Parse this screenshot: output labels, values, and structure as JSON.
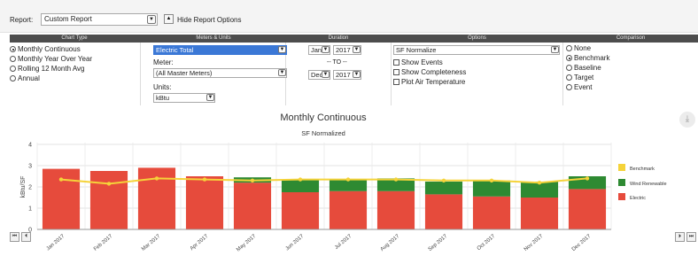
{
  "report_bar": {
    "report_label": "Report:",
    "report_value": "Custom Report",
    "hide_label": "Hide Report Options"
  },
  "headers": {
    "chart_type": "Chart Type",
    "meters_units": "Meters & Units",
    "duration": "Duration",
    "options": "Options",
    "comparison": "Comparison"
  },
  "chart_type": {
    "options": [
      "Monthly Continuous",
      "Monthly Year Over Year",
      "Rolling 12 Month Avg",
      "Annual"
    ],
    "selected": 0
  },
  "meters_units": {
    "energy_value": "Electric Total",
    "meter_label": "Meter:",
    "meter_value": "(All Master Meters)",
    "units_label": "Units:",
    "units_value": "kBtu"
  },
  "duration": {
    "from_month": "Jan",
    "from_year": "2017",
    "to_label": "-- TO --",
    "to_month": "Dec",
    "to_year": "2017"
  },
  "options": {
    "normalize_value": "SF Normalize",
    "checkboxes": [
      "Show Events",
      "Show Completeness",
      "Plot Air Temperature"
    ]
  },
  "comparison": {
    "options": [
      "None",
      "Benchmark",
      "Baseline",
      "Target",
      "Event"
    ],
    "selected": 1
  },
  "colors": {
    "electric": "#e64b3c",
    "wind": "#2e8a32",
    "benchmark": "#f5d33a",
    "header_bg": "#4d4d4d"
  },
  "chart_data": {
    "type": "bar",
    "title": "Monthly Continuous",
    "subtitle": "SF Normalized",
    "ylabel": "kBtu/SF",
    "ylim": [
      0,
      4
    ],
    "yticks": [
      "0",
      "1",
      "2",
      "3",
      "4"
    ],
    "categories": [
      "Jan 2017",
      "Feb 2017",
      "Mar 2017",
      "Apr 2017",
      "May 2017",
      "Jun 2017",
      "Jul 2017",
      "Aug 2017",
      "Sep 2017",
      "Oct 2017",
      "Nov 2017",
      "Dec 2017"
    ],
    "series": [
      {
        "name": "Electric",
        "values": [
          2.85,
          2.75,
          2.9,
          2.5,
          2.2,
          1.75,
          1.8,
          1.8,
          1.65,
          1.55,
          1.5,
          1.9
        ]
      },
      {
        "name": "Wind Renewable",
        "values": [
          0,
          0,
          0,
          0,
          0.25,
          0.6,
          0.55,
          0.6,
          0.6,
          0.75,
          0.75,
          0.6
        ]
      },
      {
        "name": "Benchmark",
        "type": "line",
        "values": [
          2.35,
          2.15,
          2.4,
          2.35,
          2.3,
          2.35,
          2.35,
          2.35,
          2.3,
          2.3,
          2.2,
          2.4
        ]
      }
    ],
    "legend": [
      "Benchmark",
      "Wind Renewable",
      "Electric"
    ],
    "legend_position": "right",
    "grid": true
  }
}
